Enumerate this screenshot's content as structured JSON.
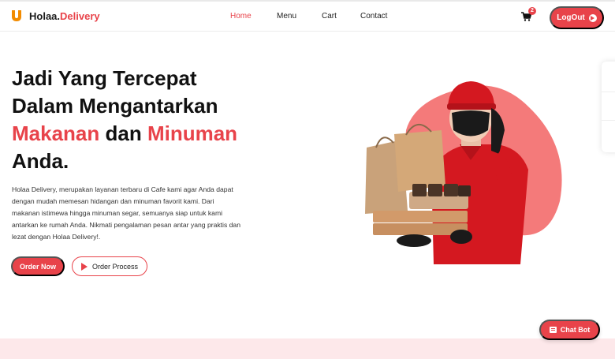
{
  "header": {
    "brand_prefix": "Holaa.",
    "brand_accent": "Delivery",
    "nav": [
      {
        "label": "Home",
        "active": true
      },
      {
        "label": "Menu",
        "active": false
      },
      {
        "label": "Cart",
        "active": false
      },
      {
        "label": "Contact",
        "active": false
      }
    ],
    "cart_count": "2",
    "logout_label": "LogOut"
  },
  "hero": {
    "title_line1": "Jadi Yang Tercepat",
    "title_line2": "Dalam Mengantarkan",
    "title_word_red1": "Makanan",
    "title_word_mid": " dan ",
    "title_word_red2": "Minuman",
    "title_line4": "Anda.",
    "description": "Holaa Delivery, merupakan layanan terbaru di Cafe kami agar Anda dapat dengan mudah memesan hidangan dan minuman favorit kami. Dari makanan istimewa hingga minuman segar, semuanya siap untuk kami antarkan ke rumah Anda. Nikmati pengalaman pesan antar yang praktis dan lezat dengan Holaa Delivery!.",
    "order_now_label": "Order Now",
    "order_process_label": "Order Process"
  },
  "chat": {
    "label": "Chat Bot"
  },
  "icons": {
    "logo": "logo-u-icon",
    "cart": "cart-icon",
    "logout": "arrow-right-circle-icon",
    "play": "play-icon",
    "chat": "chat-icon"
  },
  "colors": {
    "accent": "#e8434a",
    "blob": "#f47a7a",
    "band": "#fde8ea"
  }
}
